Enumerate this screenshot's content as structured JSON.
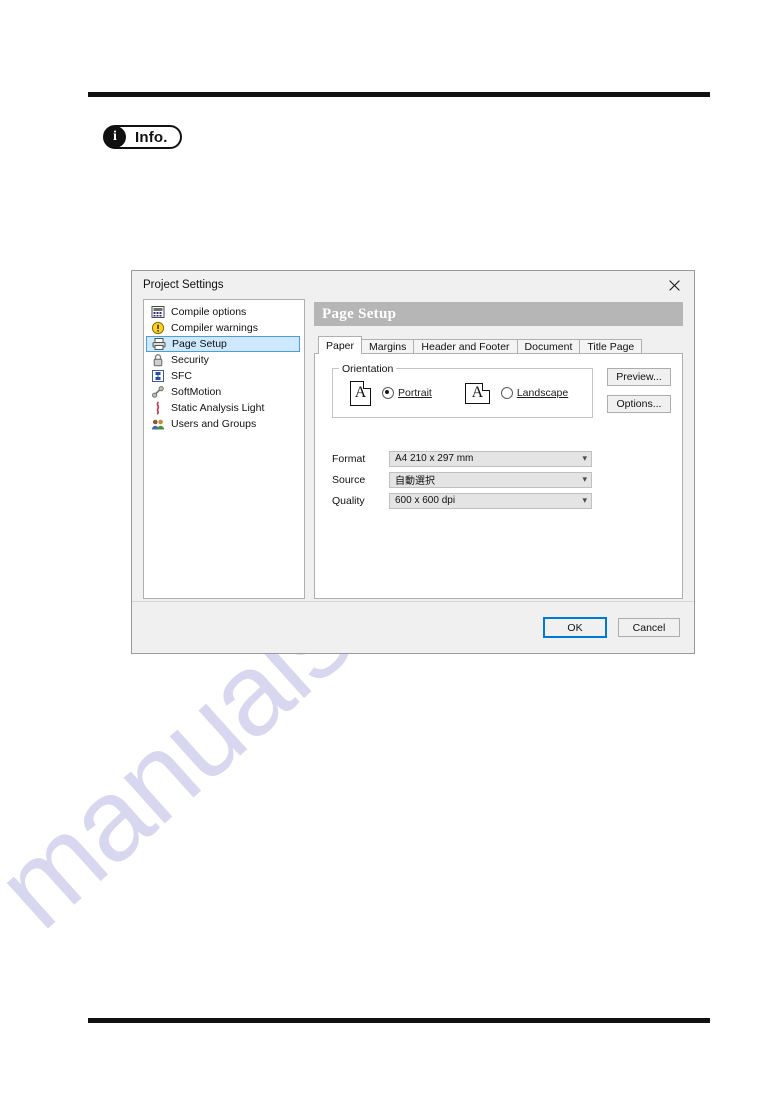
{
  "page": {
    "info_badge": {
      "icon": "info-icon",
      "glyph": "i",
      "label": "Info."
    },
    "watermark": "manualshive.com"
  },
  "dialog": {
    "title": "Project Settings",
    "close_icon": "close-icon",
    "sidebar": {
      "items": [
        {
          "label": "Compile options",
          "icon": "compile-options-icon",
          "selected": false
        },
        {
          "label": "Compiler warnings",
          "icon": "compiler-warnings-icon",
          "selected": false
        },
        {
          "label": "Page Setup",
          "icon": "page-setup-printer-icon",
          "selected": true
        },
        {
          "label": "Security",
          "icon": "security-lock-icon",
          "selected": false
        },
        {
          "label": "SFC",
          "icon": "sfc-icon",
          "selected": false
        },
        {
          "label": "SoftMotion",
          "icon": "softmotion-icon",
          "selected": false
        },
        {
          "label": "Static Analysis Light",
          "icon": "static-analysis-icon",
          "selected": false
        },
        {
          "label": "Users and Groups",
          "icon": "users-and-groups-icon",
          "selected": false
        }
      ]
    },
    "pane": {
      "header": "Page Setup",
      "tabs": [
        {
          "label": "Paper",
          "active": true
        },
        {
          "label": "Margins",
          "active": false
        },
        {
          "label": "Header and Footer",
          "active": false
        },
        {
          "label": "Document",
          "active": false
        },
        {
          "label": "Title Page",
          "active": false
        }
      ],
      "orientation": {
        "legend": "Orientation",
        "page_glyph": "A",
        "portrait": {
          "label": "Portrait",
          "selected": true
        },
        "landscape": {
          "label": "Landscape",
          "selected": false
        }
      },
      "fields": [
        {
          "label": "Format",
          "value": "A4 210 x 297 mm"
        },
        {
          "label": "Source",
          "value": "自動選択"
        },
        {
          "label": "Quality",
          "value": "600 x 600 dpi"
        }
      ],
      "side_buttons": [
        {
          "label": "Preview..."
        },
        {
          "label": "Options..."
        }
      ]
    },
    "footer": {
      "ok": "OK",
      "cancel": "Cancel"
    },
    "colors": {
      "selection": "#cde8ff",
      "selection_border": "#4a9ede",
      "pane_header_bg": "#b6b6b6",
      "focus_border": "#0078d7",
      "watermark": "#b9b7e4"
    }
  }
}
